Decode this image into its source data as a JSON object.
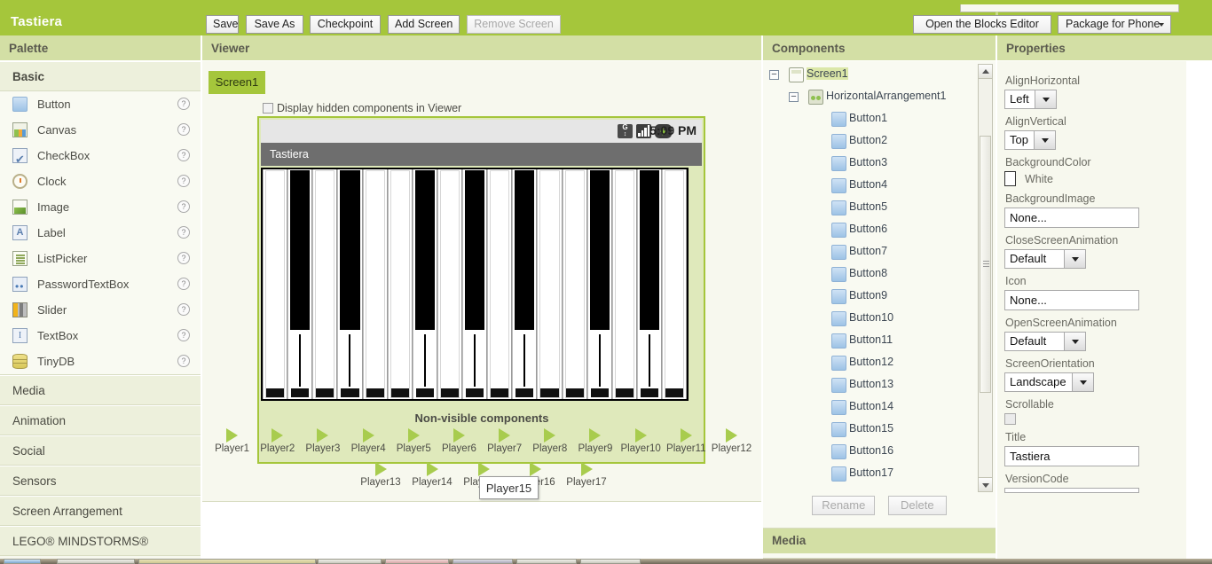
{
  "topbar": {
    "app_title": "Tastiera",
    "buttons": [
      {
        "label": "Save",
        "id": "save"
      },
      {
        "label": "Save As",
        "id": "save-as"
      },
      {
        "label": "Checkpoint",
        "id": "checkpoint"
      },
      {
        "label": "Add Screen",
        "id": "add-screen"
      },
      {
        "label": "Remove Screen",
        "id": "remove-screen",
        "disabled": true
      }
    ],
    "blocks_editor_label": "Open the Blocks Editor",
    "package_label": "Package for Phone",
    "accent_color": "#a5c63b"
  },
  "panels": {
    "palette_title": "Palette",
    "viewer_title": "Viewer",
    "components_title": "Components",
    "properties_title": "Properties"
  },
  "palette": {
    "open_section": "Basic",
    "items": [
      {
        "label": "Button",
        "icon": "button-icon",
        "help": "?"
      },
      {
        "label": "Canvas",
        "icon": "canvas-icon",
        "help": "?"
      },
      {
        "label": "CheckBox",
        "icon": "checkbox-icon",
        "help": "?"
      },
      {
        "label": "Clock",
        "icon": "clock-icon",
        "help": "?"
      },
      {
        "label": "Image",
        "icon": "image-icon",
        "help": "?"
      },
      {
        "label": "Label",
        "icon": "label-icon",
        "help": "?"
      },
      {
        "label": "ListPicker",
        "icon": "listpicker-icon",
        "help": "?"
      },
      {
        "label": "PasswordTextBox",
        "icon": "password-icon",
        "help": "?"
      },
      {
        "label": "Slider",
        "icon": "slider-icon",
        "help": "?"
      },
      {
        "label": "TextBox",
        "icon": "textbox-icon",
        "help": "?"
      },
      {
        "label": "TinyDB",
        "icon": "tinydb-icon",
        "help": "?"
      }
    ],
    "sections": [
      "Media",
      "Animation",
      "Social",
      "Sensors",
      "Screen Arrangement",
      "LEGO® MINDSTORMS®"
    ]
  },
  "viewer": {
    "screen_tab": "Screen1",
    "hidden_components_label": "Display hidden components in Viewer",
    "hidden_components_checked": false,
    "phone": {
      "status_time": "5:09 PM",
      "status_icons": [
        "gprs-icon",
        "signal-icon",
        "battery-icon"
      ],
      "title": "Tastiera",
      "keyboard_keys": [
        "white",
        "black",
        "white",
        "black",
        "white",
        "white",
        "black",
        "white",
        "black",
        "white",
        "black",
        "white",
        "white",
        "black",
        "white",
        "black",
        "white"
      ]
    },
    "nonvisible_title": "Non-visible components",
    "nonvisible_row1": [
      "Player1",
      "Player2",
      "Player3",
      "Player4",
      "Player5",
      "Player6",
      "Player7",
      "Player8",
      "Player9",
      "Player10",
      "Player11",
      "Player12"
    ],
    "nonvisible_row2": [
      "Player13",
      "Player14",
      "Player15",
      "Player16",
      "Player17"
    ],
    "tooltip_text": "Player15"
  },
  "components": {
    "tree": [
      {
        "label": "Screen1",
        "icon": "screen-icon",
        "depth": 0,
        "toggle": "−",
        "selected": true
      },
      {
        "label": "HorizontalArrangement1",
        "icon": "horizontal-arrangement-icon",
        "depth": 1,
        "toggle": "−",
        "selected": false
      },
      {
        "label": "Button1",
        "icon": "button-icon",
        "depth": 2,
        "toggle": "",
        "selected": false
      },
      {
        "label": "Button2",
        "icon": "button-icon",
        "depth": 2,
        "toggle": "",
        "selected": false
      },
      {
        "label": "Button3",
        "icon": "button-icon",
        "depth": 2,
        "toggle": "",
        "selected": false
      },
      {
        "label": "Button4",
        "icon": "button-icon",
        "depth": 2,
        "toggle": "",
        "selected": false
      },
      {
        "label": "Button5",
        "icon": "button-icon",
        "depth": 2,
        "toggle": "",
        "selected": false
      },
      {
        "label": "Button6",
        "icon": "button-icon",
        "depth": 2,
        "toggle": "",
        "selected": false
      },
      {
        "label": "Button7",
        "icon": "button-icon",
        "depth": 2,
        "toggle": "",
        "selected": false
      },
      {
        "label": "Button8",
        "icon": "button-icon",
        "depth": 2,
        "toggle": "",
        "selected": false
      },
      {
        "label": "Button9",
        "icon": "button-icon",
        "depth": 2,
        "toggle": "",
        "selected": false
      },
      {
        "label": "Button10",
        "icon": "button-icon",
        "depth": 2,
        "toggle": "",
        "selected": false
      },
      {
        "label": "Button11",
        "icon": "button-icon",
        "depth": 2,
        "toggle": "",
        "selected": false
      },
      {
        "label": "Button12",
        "icon": "button-icon",
        "depth": 2,
        "toggle": "",
        "selected": false
      },
      {
        "label": "Button13",
        "icon": "button-icon",
        "depth": 2,
        "toggle": "",
        "selected": false
      },
      {
        "label": "Button14",
        "icon": "button-icon",
        "depth": 2,
        "toggle": "",
        "selected": false
      },
      {
        "label": "Button15",
        "icon": "button-icon",
        "depth": 2,
        "toggle": "",
        "selected": false
      },
      {
        "label": "Button16",
        "icon": "button-icon",
        "depth": 2,
        "toggle": "",
        "selected": false
      },
      {
        "label": "Button17",
        "icon": "button-icon",
        "depth": 2,
        "toggle": "",
        "selected": false
      }
    ],
    "rename_label": "Rename",
    "delete_label": "Delete",
    "media_title": "Media"
  },
  "properties": {
    "align_horizontal": {
      "label": "AlignHorizontal",
      "value": "Left"
    },
    "align_vertical": {
      "label": "AlignVertical",
      "value": "Top"
    },
    "background_color": {
      "label": "BackgroundColor",
      "value": "White",
      "swatch": "#ffffff"
    },
    "background_image": {
      "label": "BackgroundImage",
      "value": "None..."
    },
    "close_screen_animation": {
      "label": "CloseScreenAnimation",
      "value": "Default"
    },
    "icon": {
      "label": "Icon",
      "value": "None..."
    },
    "open_screen_animation": {
      "label": "OpenScreenAnimation",
      "value": "Default"
    },
    "screen_orientation": {
      "label": "ScreenOrientation",
      "value": "Landscape"
    },
    "scrollable": {
      "label": "Scrollable",
      "checked": false
    },
    "title": {
      "label": "Title",
      "value": "Tastiera"
    },
    "version_code": {
      "label": "VersionCode"
    }
  }
}
